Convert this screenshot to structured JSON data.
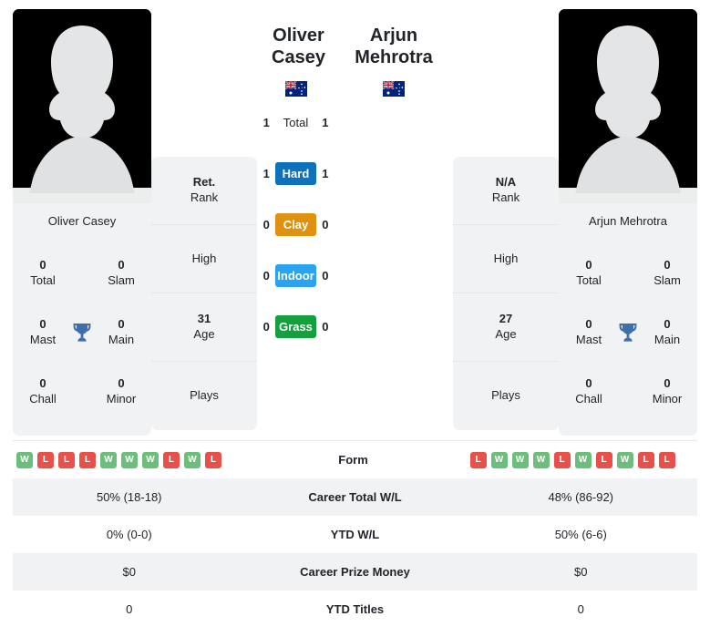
{
  "players": {
    "left": {
      "name": "Oliver Casey",
      "photo_caption": "Oliver Casey",
      "flag": "australia-flag",
      "info": [
        {
          "value": "Ret.",
          "label": "Rank"
        },
        {
          "value": "",
          "label": "High"
        },
        {
          "value": "31",
          "label": "Age"
        },
        {
          "value": "",
          "label": "Plays"
        }
      ],
      "titles": [
        {
          "num": "0",
          "label": "Total"
        },
        {
          "num": "0",
          "label": "Slam"
        },
        {
          "num": "0",
          "label": "Mast"
        },
        {
          "num": "0",
          "label": "Main"
        },
        {
          "num": "0",
          "label": "Chall"
        },
        {
          "num": "0",
          "label": "Minor"
        }
      ],
      "form": [
        "W",
        "L",
        "L",
        "L",
        "W",
        "W",
        "W",
        "L",
        "W",
        "L"
      ],
      "career_total_wl": "50% (18-18)",
      "ytd_wl": "0% (0-0)",
      "career_prize_money": "$0",
      "ytd_titles": "0"
    },
    "right": {
      "name": "Arjun Mehrotra",
      "photo_caption": "Arjun Mehrotra",
      "flag": "australia-flag",
      "info": [
        {
          "value": "N/A",
          "label": "Rank"
        },
        {
          "value": "",
          "label": "High"
        },
        {
          "value": "27",
          "label": "Age"
        },
        {
          "value": "",
          "label": "Plays"
        }
      ],
      "titles": [
        {
          "num": "0",
          "label": "Total"
        },
        {
          "num": "0",
          "label": "Slam"
        },
        {
          "num": "0",
          "label": "Mast"
        },
        {
          "num": "0",
          "label": "Main"
        },
        {
          "num": "0",
          "label": "Chall"
        },
        {
          "num": "0",
          "label": "Minor"
        }
      ],
      "form": [
        "L",
        "W",
        "W",
        "W",
        "L",
        "W",
        "L",
        "W",
        "L",
        "L"
      ],
      "career_total_wl": "48% (86-92)",
      "ytd_wl": "50% (6-6)",
      "career_prize_money": "$0",
      "ytd_titles": "0"
    }
  },
  "head_to_head": [
    {
      "label": "Total",
      "left": "1",
      "right": "1",
      "color": "none",
      "badge_color": ""
    },
    {
      "label": "Hard",
      "left": "1",
      "right": "1",
      "color": "hard",
      "badge_color": "#0d72bb"
    },
    {
      "label": "Clay",
      "left": "0",
      "right": "0",
      "color": "clay",
      "badge_color": "#de9210"
    },
    {
      "label": "Indoor",
      "left": "0",
      "right": "0",
      "color": "indoor",
      "badge_color": "#2aa3f0"
    },
    {
      "label": "Grass",
      "left": "0",
      "right": "0",
      "color": "grass",
      "badge_color": "#14a03c"
    }
  ],
  "stats_table": {
    "rows": [
      {
        "key": "form",
        "label": "Form"
      },
      {
        "key": "career_total_wl",
        "label": "Career Total W/L"
      },
      {
        "key": "ytd_wl",
        "label": "YTD W/L"
      },
      {
        "key": "career_prize_money",
        "label": "Career Prize Money"
      },
      {
        "key": "ytd_titles",
        "label": "YTD Titles"
      }
    ]
  },
  "colors": {
    "card_bg": "#f1f2f3",
    "win": "#6cbf7b",
    "loss": "#e8514a",
    "trophy": "#3d6fab",
    "text": "#212529"
  },
  "icons": {
    "trophy": "trophy-icon",
    "avatar": "person-silhouette-icon"
  }
}
